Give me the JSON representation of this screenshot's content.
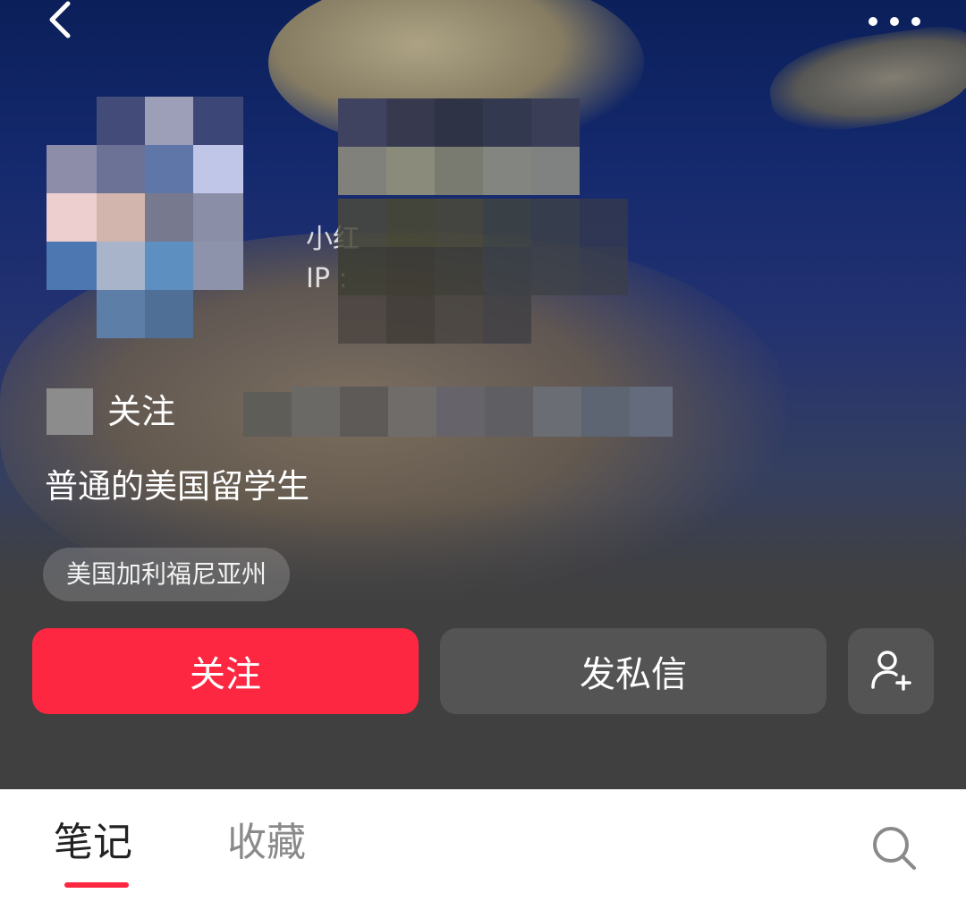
{
  "header": {
    "back_icon": "chevron-left-icon",
    "more_icon": "more-horizontal-icon"
  },
  "profile": {
    "id_label": "小红",
    "ip_label": "IP :",
    "stats": {
      "following_label": "关注"
    },
    "bio": "普通的美国留学生",
    "location": "美国加利福尼亚州"
  },
  "actions": {
    "follow_label": "关注",
    "message_label": "发私信",
    "add_friend_icon": "user-plus-icon"
  },
  "tabs": {
    "items": [
      {
        "label": "笔记",
        "active": true
      },
      {
        "label": "收藏",
        "active": false
      }
    ],
    "search_icon": "search-icon"
  },
  "colors": {
    "accent": "#fe2742",
    "secondary_button": "#545454",
    "tab_active": "#222222",
    "tab_inactive": "#8a8a8a"
  }
}
